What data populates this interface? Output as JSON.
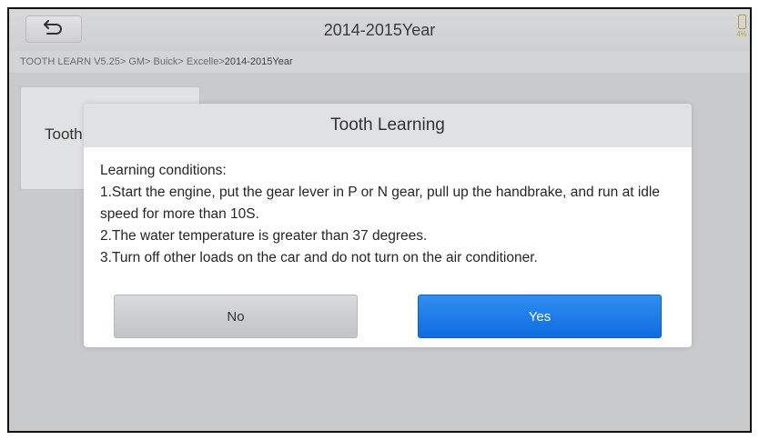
{
  "header": {
    "title": "2014-2015Year",
    "back_icon": "back-arrow-icon",
    "battery_text": "4%"
  },
  "breadcrumb": {
    "path": "TOOTH LEARN V5.25> GM> Buick> Excelle> ",
    "current": "2014-2015Year"
  },
  "menu": {
    "items": [
      {
        "label": "Tooth Learning"
      }
    ]
  },
  "dialog": {
    "title": "Tooth Learning",
    "lines": [
      "Learning conditions:",
      "1.Start the engine, put the gear lever in P or N gear, pull up the handbrake, and run at idle speed for more than 10S.",
      "2.The water temperature is greater than 37 degrees.",
      "3.Turn off other loads on the car and do not turn on the air conditioner."
    ],
    "no_label": "No",
    "yes_label": "Yes"
  },
  "colors": {
    "accent": "#1a78e8",
    "header_bg": "#d7d8da",
    "overlay_bg": "#c9cacc"
  }
}
